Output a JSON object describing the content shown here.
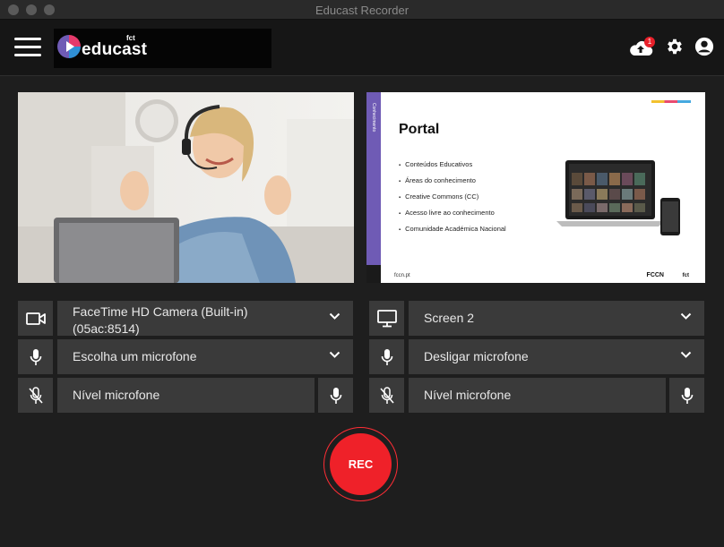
{
  "window": {
    "title": "Educast Recorder"
  },
  "header": {
    "logo_text": "educast",
    "logo_sub": "fct",
    "upload_badge": "1"
  },
  "camera_panel": {
    "device": "FaceTime HD Camera (Built-in)",
    "device_id": "(05ac:8514)",
    "microphone": "Escolha um microfone",
    "mic_level_label": "Nível microfone"
  },
  "screen_panel": {
    "source": "Screen 2",
    "microphone": "Desligar microfone",
    "mic_level_label": "Nível microfone",
    "slide": {
      "title": "Portal",
      "bullets": [
        "Conteúdos Educativos",
        "Áreas do conhecimento",
        "Creative Commons (CC)",
        "Acesso livre ao conhecimento",
        "Comunidade Académica Nacional"
      ],
      "footer_url": "fccn.pt",
      "brand": "FCCN",
      "brand2": "fct",
      "side_label": "Conhecimento"
    }
  },
  "record": {
    "label": "REC"
  },
  "colors": {
    "accent_red": "#ef2129",
    "panel": "#3a3a3a",
    "background": "#1e1e1e"
  }
}
